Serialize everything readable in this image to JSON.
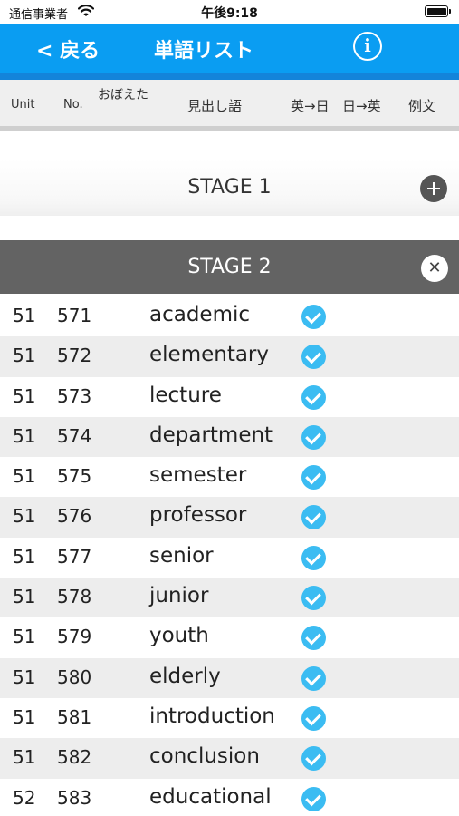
{
  "status": {
    "carrier": "通信事業者",
    "time": "午後9:18"
  },
  "nav": {
    "back_label": "< 戻る",
    "title": "単語リスト",
    "info_icon": "i"
  },
  "columns": {
    "unit": "Unit",
    "no": "No.",
    "memorized": "おぼえた",
    "headword": "見出し語",
    "en_ja": "英→日",
    "ja_en": "日→英",
    "example": "例文"
  },
  "stages": {
    "stage1": {
      "title": "STAGE 1",
      "expanded": false
    },
    "stage2": {
      "title": "STAGE 2",
      "expanded": true
    }
  },
  "colors": {
    "nav_blue": "#0a9df2",
    "check_blue": "#3bbcf2",
    "stage_open": "#636363"
  },
  "words": [
    {
      "unit": "51",
      "no": "571",
      "word": "academic",
      "en_ja_done": true
    },
    {
      "unit": "51",
      "no": "572",
      "word": "elementary",
      "en_ja_done": true
    },
    {
      "unit": "51",
      "no": "573",
      "word": "lecture",
      "en_ja_done": true
    },
    {
      "unit": "51",
      "no": "574",
      "word": "department",
      "en_ja_done": true
    },
    {
      "unit": "51",
      "no": "575",
      "word": "semester",
      "en_ja_done": true
    },
    {
      "unit": "51",
      "no": "576",
      "word": "professor",
      "en_ja_done": true
    },
    {
      "unit": "51",
      "no": "577",
      "word": "senior",
      "en_ja_done": true
    },
    {
      "unit": "51",
      "no": "578",
      "word": "junior",
      "en_ja_done": true
    },
    {
      "unit": "51",
      "no": "579",
      "word": "youth",
      "en_ja_done": true
    },
    {
      "unit": "51",
      "no": "580",
      "word": "elderly",
      "en_ja_done": true
    },
    {
      "unit": "51",
      "no": "581",
      "word": "introduction",
      "en_ja_done": true
    },
    {
      "unit": "51",
      "no": "582",
      "word": "conclusion",
      "en_ja_done": true
    },
    {
      "unit": "52",
      "no": "583",
      "word": "educational",
      "en_ja_done": true
    }
  ]
}
